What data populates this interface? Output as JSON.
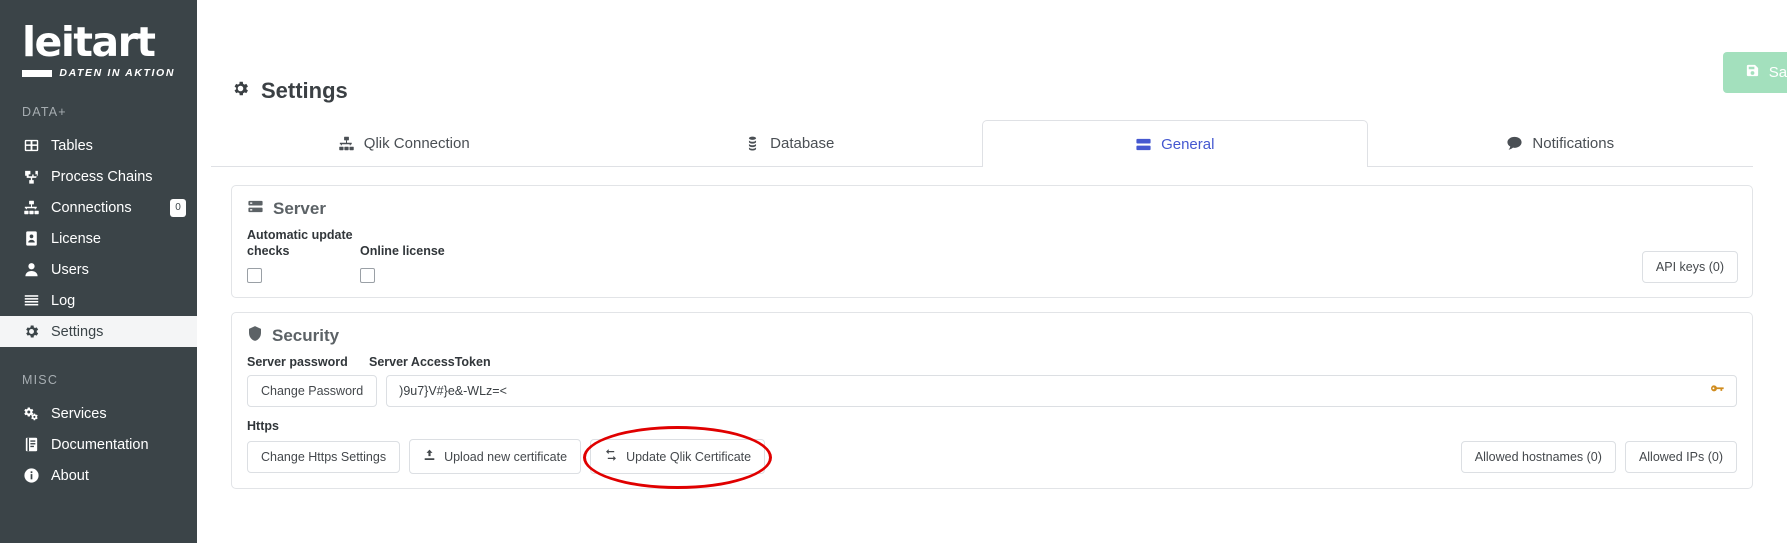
{
  "sidebar": {
    "logo": {
      "word": "leitart",
      "subtitle": "DATEN IN AKTION"
    },
    "sections": [
      {
        "label": "DATA+",
        "items": [
          {
            "label": "Tables",
            "icon": "table-icon",
            "badge": null,
            "active": false
          },
          {
            "label": "Process Chains",
            "icon": "sitemap-icon",
            "badge": null,
            "active": false
          },
          {
            "label": "Connections",
            "icon": "network-icon",
            "badge": "0",
            "active": false
          },
          {
            "label": "License",
            "icon": "id-card-icon",
            "badge": null,
            "active": false
          },
          {
            "label": "Users",
            "icon": "user-icon",
            "badge": null,
            "active": false
          },
          {
            "label": "Log",
            "icon": "list-icon",
            "badge": null,
            "active": false
          },
          {
            "label": "Settings",
            "icon": "gear-icon",
            "badge": null,
            "active": true
          }
        ]
      },
      {
        "label": "MISC",
        "items": [
          {
            "label": "Services",
            "icon": "cogs-icon",
            "badge": null,
            "active": false
          },
          {
            "label": "Documentation",
            "icon": "book-icon",
            "badge": null,
            "active": false
          },
          {
            "label": "About",
            "icon": "info-circle-icon",
            "badge": null,
            "active": false
          }
        ]
      }
    ]
  },
  "header": {
    "title": "Settings",
    "title_icon": "gear-icon",
    "save_label": "Save",
    "save_icon": "save-icon",
    "save_color": "#a3e0bd"
  },
  "tabs": [
    {
      "label": "Qlik Connection",
      "icon": "network-icon",
      "active": false
    },
    {
      "label": "Database",
      "icon": "database-icon",
      "active": false
    },
    {
      "label": "General",
      "icon": "server-icon",
      "active": true
    },
    {
      "label": "Notifications",
      "icon": "comment-icon",
      "active": false
    }
  ],
  "active_tab_color": "#4558d0",
  "server_panel": {
    "title": "Server",
    "icon": "server-icon",
    "auto_update_label": "Automatic update checks",
    "auto_update_checked": false,
    "online_license_label": "Online license",
    "online_license_checked": false,
    "api_keys_label": "API keys (0)"
  },
  "security_panel": {
    "title": "Security",
    "icon": "shield-icon",
    "server_password_label": "Server password",
    "change_password_label": "Change Password",
    "access_token_label": "Server AccessToken",
    "access_token_value": ")9u7}V#}e&-WLz=<",
    "access_token_icon": "key-icon",
    "https_label": "Https",
    "change_https_label": "Change Https Settings",
    "upload_cert_label": "Upload new certificate",
    "upload_cert_icon": "upload-icon",
    "update_qlik_label": "Update Qlik Certificate",
    "update_qlik_icon": "exchange-icon",
    "allowed_hostnames_label": "Allowed hostnames (0)",
    "allowed_ips_label": "Allowed IPs (0)"
  },
  "annotation": {
    "shape": "ellipse",
    "color": "#e00000",
    "targets": "update-qlik-certificate-button"
  }
}
